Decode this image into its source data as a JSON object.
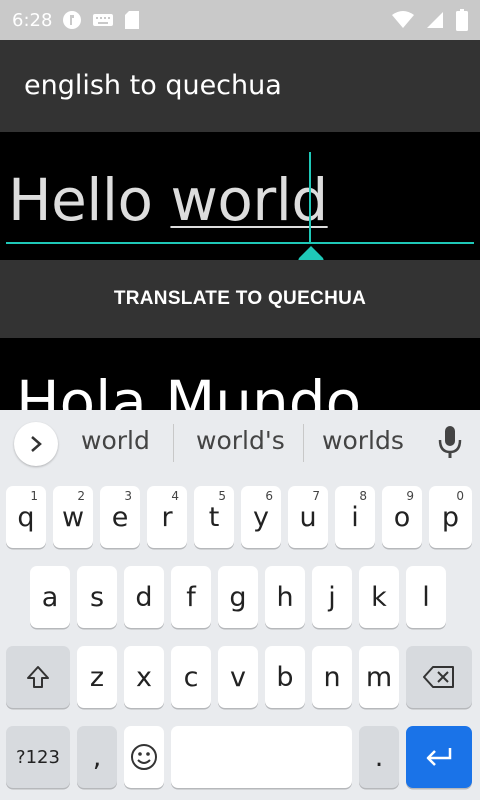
{
  "status_bar": {
    "time": "6:28"
  },
  "app_bar": {
    "title": "english to quechua"
  },
  "input": {
    "text_plain": "Hello ",
    "text_underlined": "world"
  },
  "translate_button": {
    "label": "TRANSLATE TO QUECHUA"
  },
  "output": {
    "text": "Hola Mundo"
  },
  "keyboard": {
    "suggestions": [
      "world",
      "world's",
      "worlds"
    ],
    "row1": [
      {
        "label": "q",
        "hint": "1"
      },
      {
        "label": "w",
        "hint": "2"
      },
      {
        "label": "e",
        "hint": "3"
      },
      {
        "label": "r",
        "hint": "4"
      },
      {
        "label": "t",
        "hint": "5"
      },
      {
        "label": "y",
        "hint": "6"
      },
      {
        "label": "u",
        "hint": "7"
      },
      {
        "label": "i",
        "hint": "8"
      },
      {
        "label": "o",
        "hint": "9"
      },
      {
        "label": "p",
        "hint": "0"
      }
    ],
    "row2": [
      "a",
      "s",
      "d",
      "f",
      "g",
      "h",
      "j",
      "k",
      "l"
    ],
    "row3": [
      "z",
      "x",
      "c",
      "v",
      "b",
      "n",
      "m"
    ],
    "symbols_label": "?123",
    "comma_label": ",",
    "period_label": "."
  },
  "colors": {
    "accent": "#1fc8b8",
    "enter_key": "#1a73e8",
    "app_bar": "#333333"
  }
}
